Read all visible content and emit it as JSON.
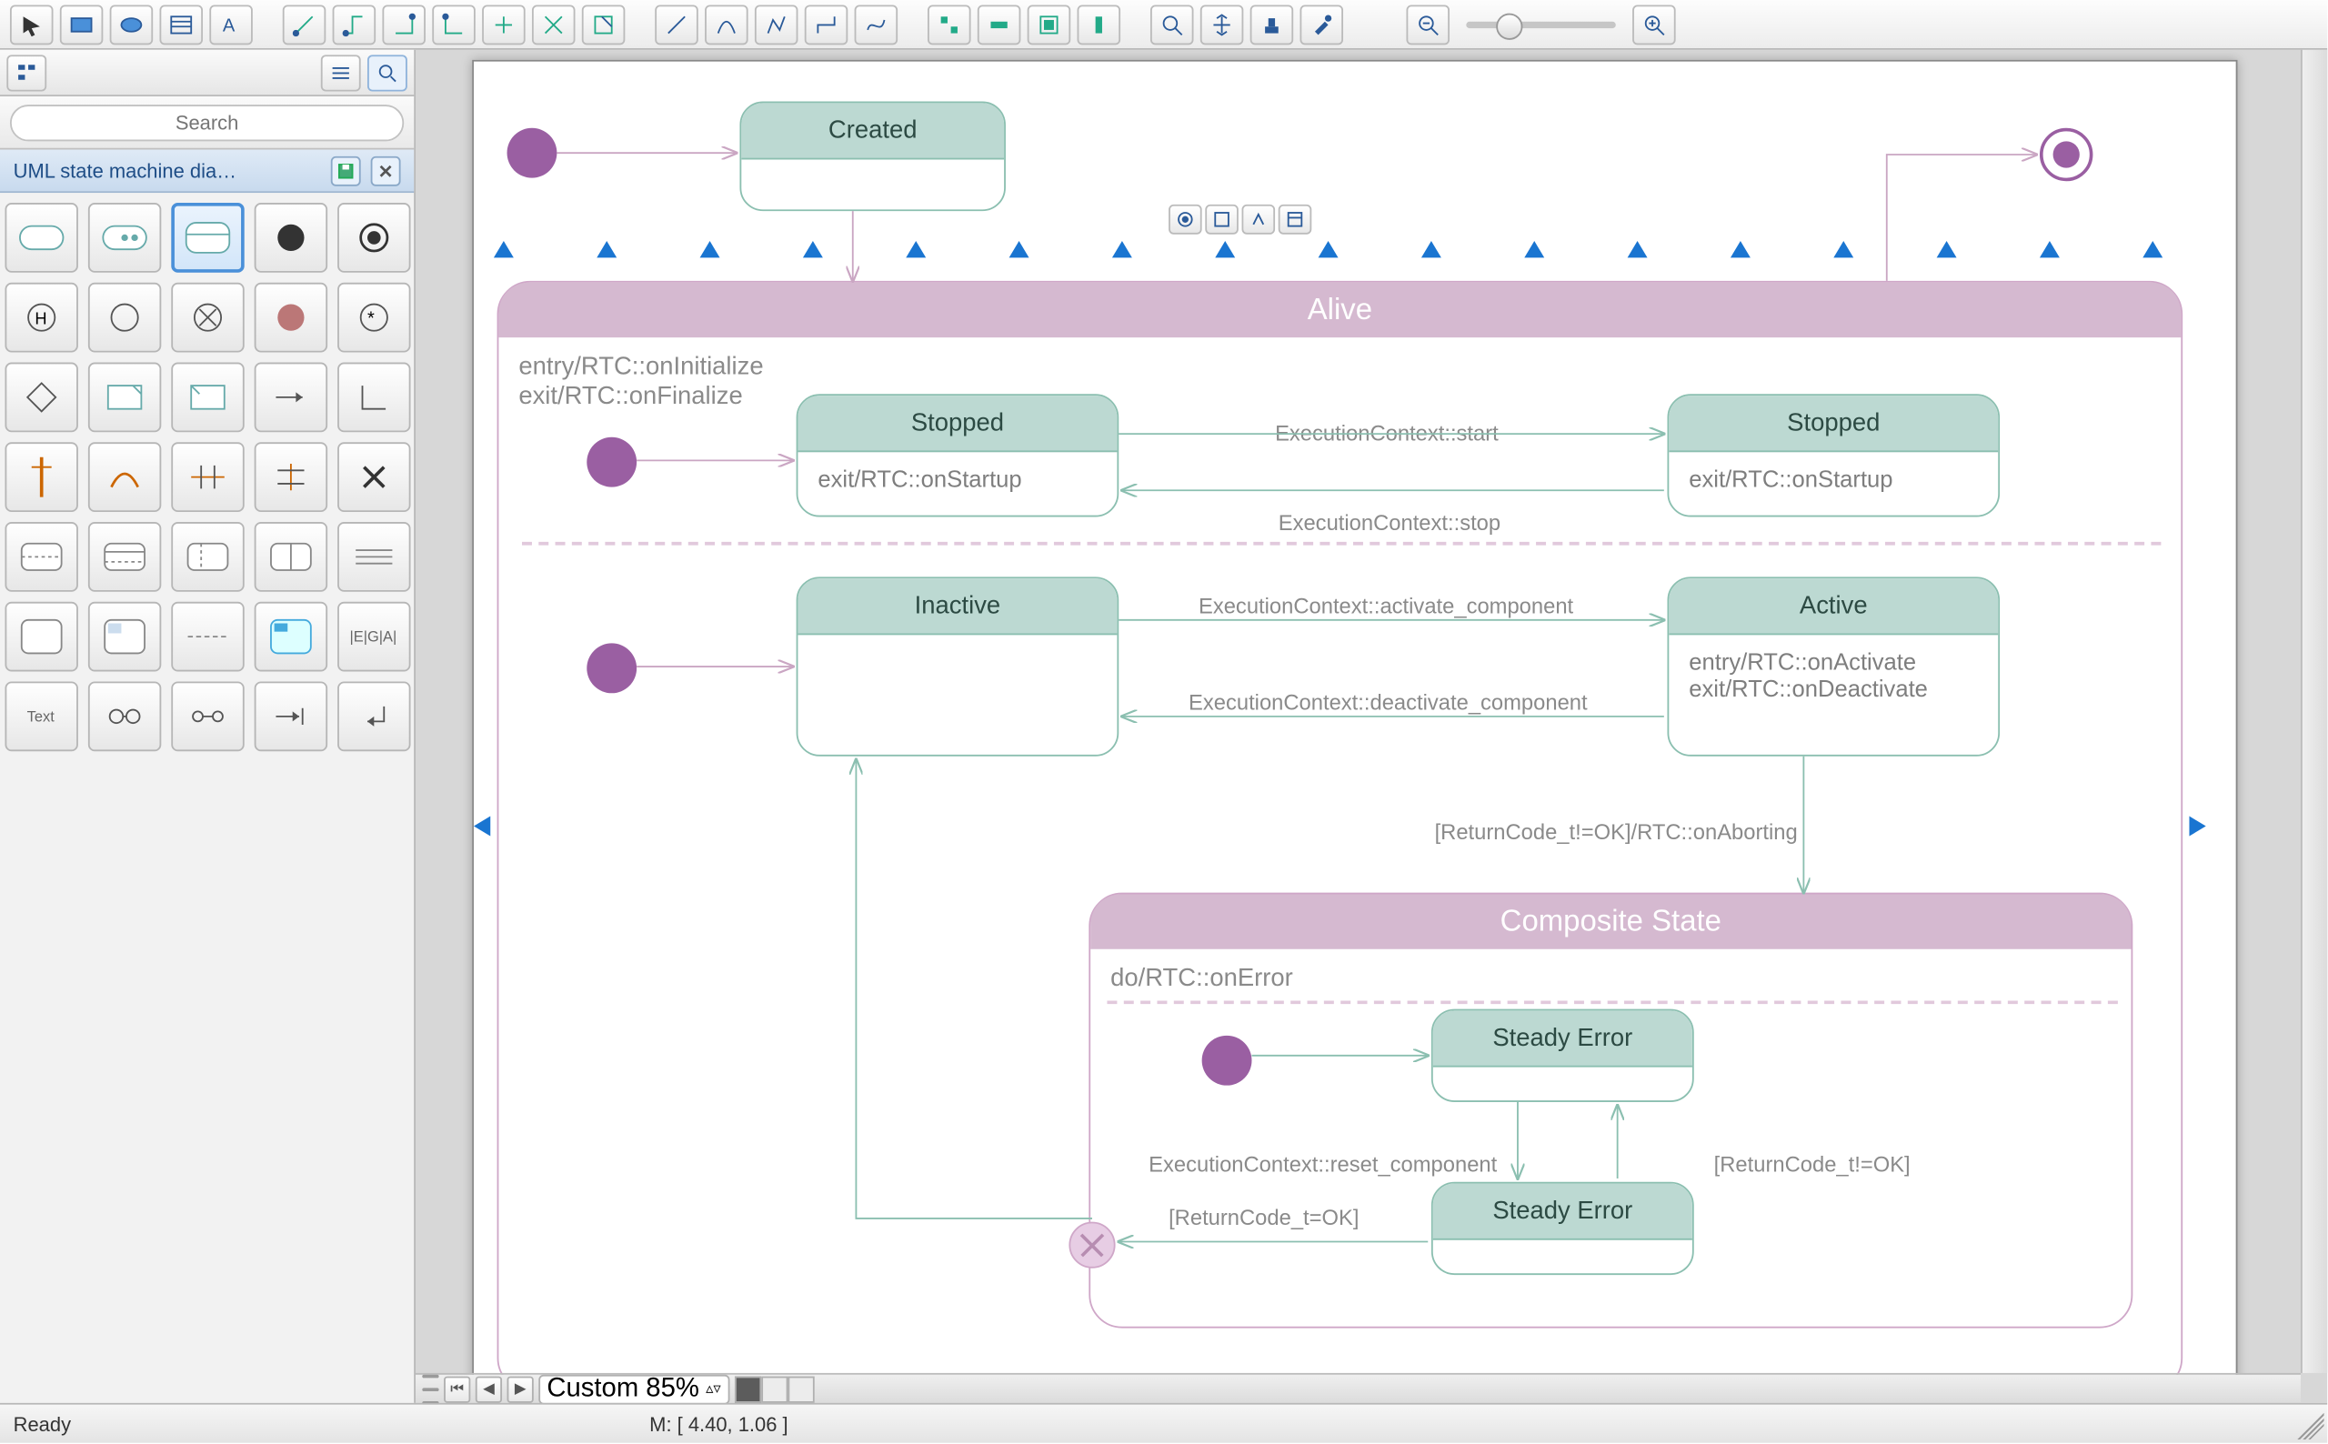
{
  "toolbar": {
    "groups": [
      [
        "pointer",
        "rect",
        "ellipse",
        "table",
        "text-tool"
      ],
      [
        "connector-1",
        "connector-2",
        "connector-3",
        "connector-4",
        "connector-5",
        "connector-6",
        "connector-7"
      ],
      [
        "line-straight",
        "line-curve",
        "line-poly",
        "line-ortho",
        "line-free"
      ],
      [
        "align-1",
        "align-2",
        "align-3",
        "align-4"
      ],
      [
        "zoom-tool",
        "pan-tool",
        "stamp-tool",
        "eyedropper-tool"
      ]
    ],
    "zoom_out_icon": "−",
    "zoom_in_icon": "+"
  },
  "sidebar": {
    "top_buttons": [
      "tree-icon",
      "blank",
      "blank",
      "blank",
      "blank",
      "list-icon",
      "search-icon"
    ],
    "search_placeholder": "Search",
    "palette_title": "UML state machine dia…",
    "header_buttons": [
      "save-icon",
      "close-icon"
    ],
    "palette_items": [
      "simple-state",
      "substate",
      "composite-state-selected",
      "final-state",
      "shallow-final",
      "history-h",
      "circle",
      "circle-x",
      "filled-node",
      "star-node",
      "diamond",
      "note",
      "note2",
      "arrow-right",
      "corner",
      "fork-vert",
      "fork-arc",
      "cross-join",
      "cross-join2",
      "x",
      "region-1",
      "region-2",
      "region-3",
      "region-4",
      "region-lines",
      "region-big",
      "region-split",
      "dashed-line",
      "region-marked",
      "ega-text",
      "text-label",
      "glasses",
      "link-oo",
      "arrow-exit",
      "return-arrow"
    ]
  },
  "mini_toolbar": [
    "opt-a",
    "opt-b",
    "opt-c",
    "opt-d"
  ],
  "diagram": {
    "alive": {
      "title": "Alive",
      "entry": "entry/RTC::onInitialize",
      "exit": "exit/RTC::onFinalize"
    },
    "created": {
      "title": "Created"
    },
    "stopped_left": {
      "title": "Stopped",
      "body": "exit/RTC::onStartup"
    },
    "stopped_right": {
      "title": "Stopped",
      "body": "exit/RTC::onStartup"
    },
    "inactive": {
      "title": "Inactive"
    },
    "active": {
      "title": "Active",
      "body1": "entry/RTC::onActivate",
      "body2": "exit/RTC::onDeactivate"
    },
    "composite": {
      "title": "Composite State",
      "do": "do/RTC::onError"
    },
    "steady_err_top": {
      "title": "Steady Error"
    },
    "steady_err_bottom": {
      "title": "Steady Error"
    },
    "transitions": {
      "t_start": "ExecutionContext::start",
      "t_stop": "ExecutionContext::stop",
      "t_activate": "ExecutionContext::activate_component",
      "t_deact": "ExecutionContext::deactivate_component",
      "t_abort": "[ReturnCode_t!=OK]/RTC::onAborting",
      "t_reset": "ExecutionContext::reset_component",
      "t_retok": "[ReturnCode_t=OK]",
      "t_retnok": "[ReturnCode_t!=OK]"
    }
  },
  "statusbar": {
    "ready": "Ready",
    "zoom_label": "Custom 85%",
    "mouse_label": "M: [ 4.40, 1.06 ]"
  }
}
